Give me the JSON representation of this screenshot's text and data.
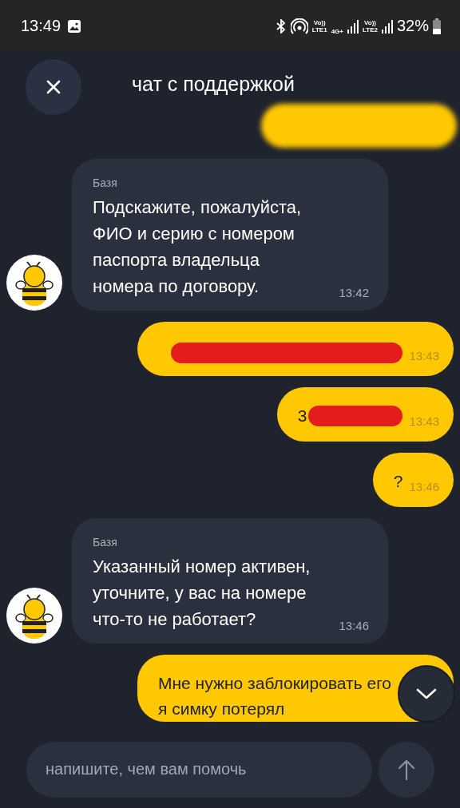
{
  "status_bar": {
    "time": "13:49",
    "sim_1": {
      "top": "Vo))",
      "bottom": "LTE1"
    },
    "network": "4G+",
    "sim_2": {
      "top": "Vo))",
      "bottom": "LTE2"
    },
    "battery": "32%"
  },
  "header": {
    "title": "чат с поддержкой"
  },
  "messages": [
    {
      "kind": "user",
      "blurred": true
    },
    {
      "kind": "bot",
      "sender": "Базя",
      "text": "Подскажите, пожалуйста, ФИО и серию с номером паспорта владельца номера по договору.",
      "time": "13:42"
    },
    {
      "kind": "user",
      "redacted": true,
      "time": "13:43"
    },
    {
      "kind": "user",
      "text": "3",
      "redacted": true,
      "time": "13:43"
    },
    {
      "kind": "user",
      "text": "?",
      "time": "13:46"
    },
    {
      "kind": "bot",
      "sender": "Базя",
      "text": "Указанный номер активен, уточните, у вас на номере что-то не работает?",
      "time": "13:46"
    },
    {
      "kind": "user",
      "text": "Мне нужно заблокировать его я симку потерял"
    }
  ],
  "composer": {
    "placeholder": "напишите, чем вам помочь"
  }
}
